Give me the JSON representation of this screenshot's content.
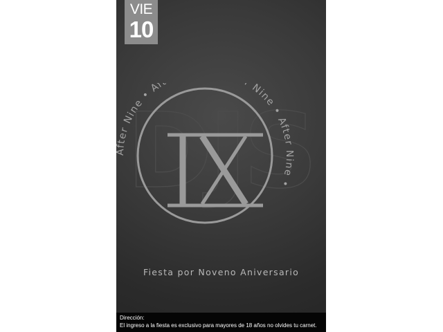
{
  "date_badge": {
    "weekday": "VIE",
    "day": "10"
  },
  "emblem": {
    "watermark": "DJS",
    "numeral": "IX",
    "ring_text": "After Nine • After Nine • After Nine • After Nine • "
  },
  "subtitle": "Fiesta por Noveno Aniversario",
  "footer": {
    "label": "Dirección:",
    "text": "El ingreso a la fiesta es exclusivo para mayores de 18 años no olvides tu carnet."
  },
  "colors": {
    "background": "#333333",
    "badge": "#8c8c8c",
    "emblem": "#999999",
    "footer": "#050505"
  }
}
